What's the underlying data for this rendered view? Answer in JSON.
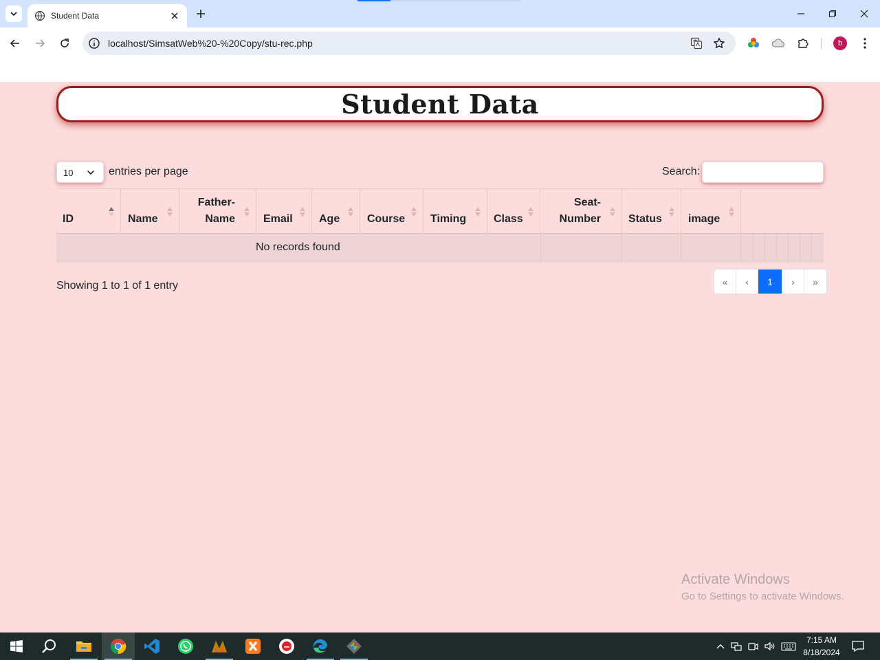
{
  "browser": {
    "tab_title": "Student Data",
    "url": "localhost/SimsatWeb%20-%20Copy/stu-rec.php"
  },
  "page": {
    "heading": "Student Data",
    "length_value": "10",
    "length_label": "entries per page",
    "search_label": "Search:",
    "search_value": "",
    "columns": [
      "ID",
      "Name",
      "Father-\nName",
      "Email",
      "Age",
      "Course",
      "Timing",
      "Class",
      "Seat-\nNumber",
      "Status",
      "image"
    ],
    "empty_message": "No records found",
    "info": "Showing 1 to 1 of 1 entry",
    "pagination": [
      "«",
      "‹",
      "1",
      "›",
      "»"
    ],
    "active_page": "1"
  },
  "watermark": {
    "line1": "Activate Windows",
    "line2": "Go to Settings to activate Windows."
  },
  "taskbar": {
    "time": "7:15 AM",
    "date": "8/18/2024",
    "apps": [
      "start-icon",
      "search-icon",
      "file-explorer-icon",
      "chrome-icon",
      "vscode-icon",
      "whatsapp-icon",
      "ahk-icon",
      "xampp-icon",
      "app-red-icon",
      "edge-icon",
      "git-gui-icon"
    ]
  },
  "colors": {
    "page_bg": "#fcdcdc",
    "heading_border": "#9b1c1c",
    "active_page": "#0d6efd"
  }
}
